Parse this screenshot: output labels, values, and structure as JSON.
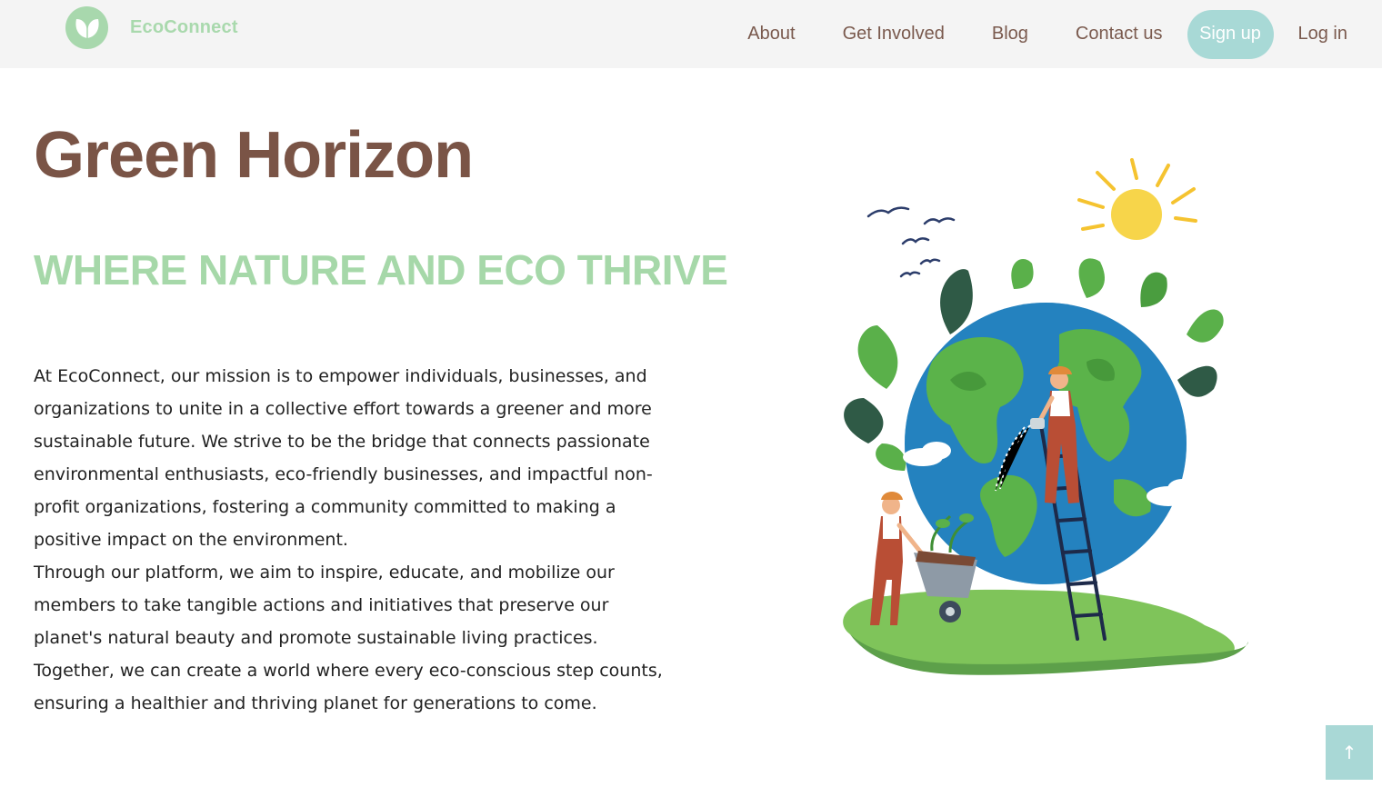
{
  "brand": {
    "name": "EcoConnect",
    "logo_icon": "leaf-icon"
  },
  "nav": {
    "links": [
      "About",
      "Get Involved",
      "Blog",
      "Contact us"
    ],
    "signup_label": "Sign up",
    "login_label": "Log in"
  },
  "hero": {
    "title": "Green Horizon",
    "subtitle": "WHERE NATURE AND ECO THRIVE",
    "paragraphs": [
      "At EcoConnect, our mission is to empower individuals, businesses, and organizations to unite in a collective effort towards a greener and more sustainable future. We strive to be the bridge that connects passionate environmental enthusiasts, eco-friendly businesses, and impactful non-profit organizations, fostering a community committed to making a positive impact on the environment.",
      "Through our platform, we aim to inspire, educate, and mobilize our members to take tangible actions and initiatives that preserve our planet's natural beauty and promote sustainable living practices. Together, we can create a world where every eco-conscious step counts, ensuring a healthier and thriving planet for generations to come."
    ]
  },
  "scroll_top": {
    "icon": "arrow-up-icon",
    "glyph": "↑"
  },
  "colors": {
    "brand_green": "#a9d9ad",
    "title_brown": "#7a5446",
    "nav_text": "#7a5a4e",
    "button_teal": "#a8d9d6",
    "navbar_bg": "#f4f4f4"
  }
}
